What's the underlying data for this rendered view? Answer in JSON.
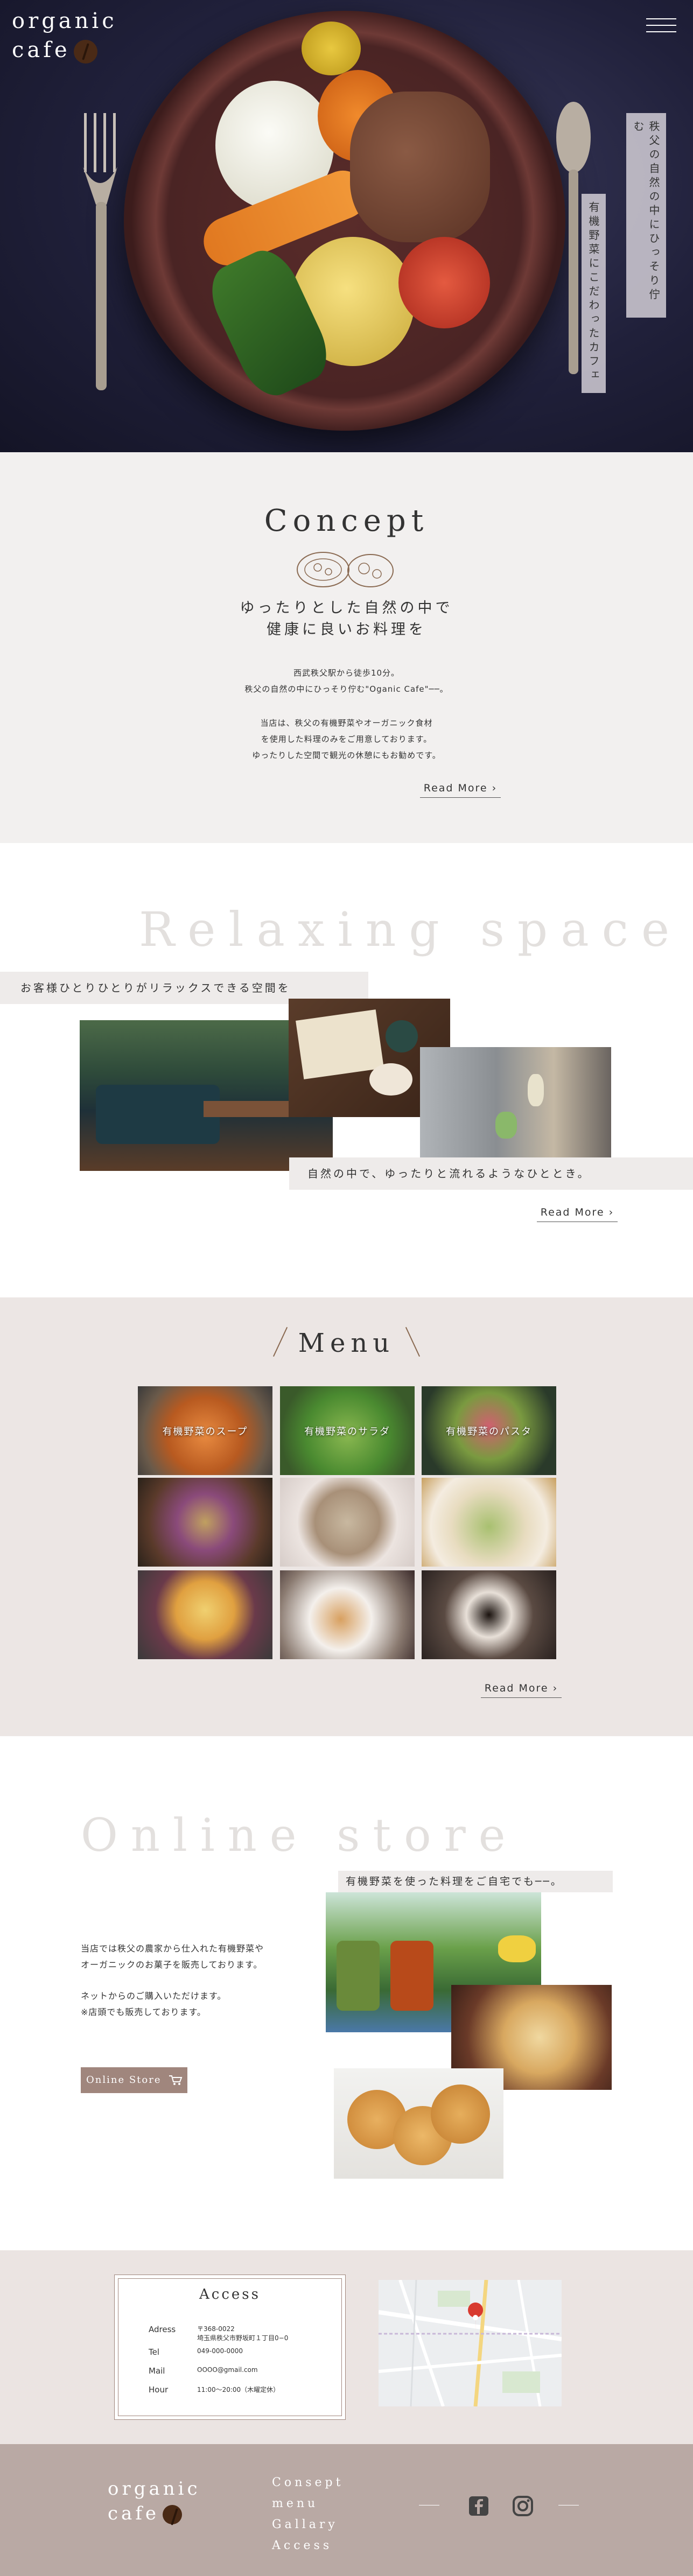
{
  "header": {
    "logo_line1": "organic",
    "logo_line2": "cafe",
    "tagline1": "秩父の自然の中にひっそり佇む",
    "tagline2": "有機野菜にこだわったカフェ"
  },
  "concept": {
    "title": "Concept",
    "headline1": "ゆったりとした自然の中で",
    "headline2": "健康に良いお料理を",
    "p1_line1": "西武秩父駅から徒歩10分。",
    "p1_line2": "秩父の自然の中にひっそり佇む\"Oganic Cafe\"──。",
    "p2_line1": "当店は、秩父の有機野菜やオーガニック食材",
    "p2_line2": "を使用した料理のみをご用意しております。",
    "p2_line3": "ゆったりした空間で観光の休憩にもお勧めです。",
    "read_more": "Read More"
  },
  "relax": {
    "title": "Relaxing space",
    "band1": "お客様ひとりひとりがリラックスできる空間を",
    "band2": "自然の中で、ゆったりと流れるようなひととき。",
    "read_more": "Read More"
  },
  "menu": {
    "title": "Menu",
    "items": [
      "有機野菜のスープ",
      "有機野菜のサラダ",
      "有機野菜のパスタ",
      "",
      "",
      "",
      "",
      "",
      ""
    ],
    "read_more": "Read More"
  },
  "store": {
    "title": "Online store",
    "band": "有機野菜を使った料理をご自宅でも──。",
    "p1_line1": "当店では秩父の農家から仕入れた有機野菜や",
    "p1_line2": "オーガニックのお菓子を販売しております。",
    "p2_line1": "ネットからのご購入いただけます。",
    "p2_line2": "※店頭でも販売しております。",
    "button": "Online Store"
  },
  "access": {
    "title": "Access",
    "rows": [
      {
        "label": "Adress",
        "value1": "〒368-0022",
        "value2": "埼玉県秩父市野坂町１丁目0−0"
      },
      {
        "label": "Tel",
        "value1": "049-000-0000",
        "value2": ""
      },
      {
        "label": "Mail",
        "value1": "OOOO@gmail.com",
        "value2": ""
      },
      {
        "label": "Hour",
        "value1": "11:00〜20:00（木曜定休）",
        "value2": ""
      }
    ]
  },
  "footer": {
    "logo_line1": "organic",
    "logo_line2": "cafe",
    "links": [
      "Consept",
      "menu",
      "Gallary",
      "Access"
    ]
  },
  "colors": {
    "accent": "#a0867d",
    "band": "#eeebea",
    "footer": "#b9a9a4"
  },
  "icons": [
    "menu-icon",
    "fork-icon",
    "spoon-icon",
    "illustration-icon",
    "cart-icon",
    "facebook-icon",
    "instagram-icon",
    "map-pin-icon"
  ]
}
